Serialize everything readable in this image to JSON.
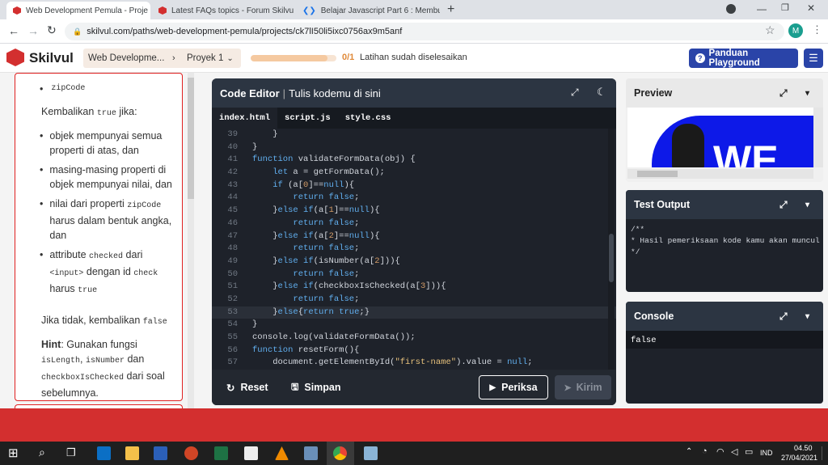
{
  "browser": {
    "tabs": [
      {
        "title": "Web Development Pemula - Proje",
        "active": true
      },
      {
        "title": "Latest FAQs topics - Forum Skilvu",
        "active": false
      },
      {
        "title": "Belajar Javascript Part 6 : Membu",
        "active": false
      }
    ],
    "url": "skilvul.com/paths/web-development-pemula/projects/ck7lI50li5ixc0756ax9m5anf",
    "profile_initial": "M"
  },
  "appbar": {
    "logo": "Skilvul",
    "crumb_path": "Web Developme...",
    "crumb_project": "Proyek 1",
    "progress": {
      "count": "0/1",
      "text": "Latihan sudah diselesaikan",
      "fraction": 0.9
    },
    "guide_button": "Panduan Playground"
  },
  "instructions": {
    "bullet_top": "zipCode",
    "return_true_prefix": "Kembalikan",
    "return_true_code": "true",
    "return_true_suffix": "jika:",
    "b1": "objek mempunyai semua properti di atas, dan",
    "b2": "masing-masing properti di objek mempunyai nilai, dan",
    "b3_pre": "nilai dari properti",
    "b3_code": "zipCode",
    "b3_post": "harus dalam bentuk angka, dan",
    "b4_pre": "attribute",
    "b4_code1": "checked",
    "b4_mid": "dari",
    "b4_code2": "<input>",
    "b4_mid2": "dengan id",
    "b4_code3": "check",
    "b4_post": "harus",
    "b4_code4": "true",
    "else_pre": "Jika tidak, kembalikan",
    "else_code": "false",
    "hint_label": "Hint",
    "hint_pre": ": Gunakan fungsi",
    "hint_code1": "isLength",
    "hint_code2": "isNumber",
    "hint_and": "dan",
    "hint_code3": "checkboxIsChecked",
    "hint_post": "dari soal sebelumnya."
  },
  "editor": {
    "title_bold": "Code Editor",
    "title_rest": "Tulis kodemu di sini",
    "files": [
      "index.html",
      "script.js",
      "style.css"
    ],
    "lines": [
      {
        "n": "39",
        "code": "    }"
      },
      {
        "n": "40",
        "code": "}"
      },
      {
        "n": "41",
        "code": "function validateFormData(obj) {"
      },
      {
        "n": "42",
        "code": "    let a = getFormData();"
      },
      {
        "n": "43",
        "code": "    if (a[0]==null){"
      },
      {
        "n": "44",
        "code": "        return false;"
      },
      {
        "n": "45",
        "code": "    }else if(a[1]==null){"
      },
      {
        "n": "46",
        "code": "        return false;"
      },
      {
        "n": "47",
        "code": "    }else if(a[2]==null){"
      },
      {
        "n": "48",
        "code": "        return false;"
      },
      {
        "n": "49",
        "code": "    }else if(isNumber(a[2])){"
      },
      {
        "n": "50",
        "code": "        return false;"
      },
      {
        "n": "51",
        "code": "    }else if(checkboxIsChecked(a[3])){"
      },
      {
        "n": "52",
        "code": "        return false;"
      },
      {
        "n": "53",
        "code": "    }else{return true;}"
      },
      {
        "n": "54",
        "code": "}"
      },
      {
        "n": "55",
        "code": "console.log(validateFormData());"
      },
      {
        "n": "56",
        "code": "function resetForm(){"
      },
      {
        "n": "57",
        "code": "    document.getElementById(\"first-name\").value = null;"
      }
    ],
    "reset": "Reset",
    "save": "Simpan",
    "check": "Periksa",
    "submit": "Kirim"
  },
  "preview": {
    "title": "Preview",
    "banner_text": "WE"
  },
  "test_output": {
    "title": "Test Output",
    "lines": [
      "/**",
      "* Hasil pemeriksaan kode kamu akan muncul",
      "*/"
    ]
  },
  "console": {
    "title": "Console",
    "output": "false"
  },
  "taskbar": {
    "lang": "IND",
    "time": "04.50",
    "date": "27/04/2021"
  },
  "colors": {
    "brand_red": "#d32f2f",
    "guide_blue": "#2a44a8",
    "progress_orange": "#f5c9a0",
    "editor_bg": "#1e222a"
  }
}
